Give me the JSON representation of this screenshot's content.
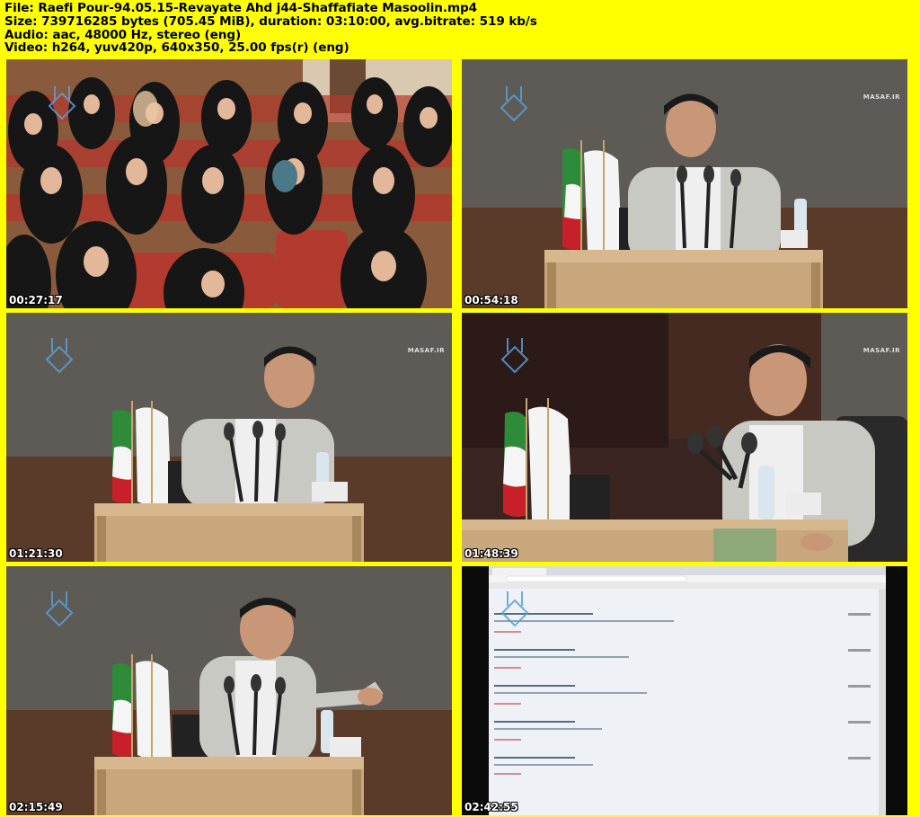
{
  "header": {
    "file": "File: Raefi Pour-94.05.15-Revayate Ahd j44-Shaffafiate Masoolin.mp4",
    "size": "Size: 739716285 bytes (705.45 MiB), duration: 03:10:00, avg.bitrate: 519 kb/s",
    "audio": "Audio: aac, 48000 Hz, stereo (eng)",
    "video": "Video: h264, yuv420p, 640x350, 25.00 fps(r) (eng)"
  },
  "thumbnails": [
    {
      "timestamp": "00:27:17",
      "scene": "audience"
    },
    {
      "timestamp": "00:54:18",
      "scene": "speaker",
      "watermark": "MASAF.IR"
    },
    {
      "timestamp": "01:21:30",
      "scene": "speaker",
      "watermark": "MASAF.IR"
    },
    {
      "timestamp": "01:48:39",
      "scene": "speaker-closeup",
      "watermark": "MASAF.IR"
    },
    {
      "timestamp": "02:15:49",
      "scene": "speaker-gesture"
    },
    {
      "timestamp": "02:42:55",
      "scene": "browser-screen"
    }
  ],
  "colors": {
    "background": "#ffff00",
    "wall": "#5e5a55",
    "podium": "#c9a77c",
    "seats": "#b23a2e"
  }
}
